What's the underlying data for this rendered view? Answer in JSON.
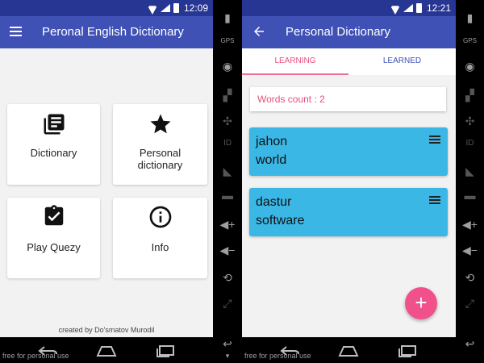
{
  "colors": {
    "status_bar": "#273593",
    "app_bar": "#3f51b5",
    "accent_pink": "#e94e7a",
    "word_card": "#3bb7e6",
    "fab": "#f0518b"
  },
  "left_screen": {
    "status_time": "12:09",
    "title": "Peronal English Dictionary",
    "tiles": [
      {
        "label": "Dictionary",
        "icon": "library-books-icon"
      },
      {
        "label": "Personal dictionary",
        "icon": "star-icon"
      },
      {
        "label": "Play Quezy",
        "icon": "clipboard-check-icon"
      },
      {
        "label": "Info",
        "icon": "info-icon"
      }
    ],
    "credit": "created by Do'smatov Murodil",
    "watermark": "free for personal use"
  },
  "right_screen": {
    "status_time": "12:21",
    "title": "Personal Dictionary",
    "tabs": [
      {
        "label": "LEARNING",
        "active": true
      },
      {
        "label": "LEARNED",
        "active": false
      }
    ],
    "words_count": "Words count : 2",
    "words": [
      {
        "word": "jahon",
        "translation": "world"
      },
      {
        "word": "dastur",
        "translation": "software"
      }
    ],
    "fab_label": "+",
    "watermark": "free for personal use"
  },
  "emulator_side_icons": [
    "battery-icon",
    "gps-icon",
    "camera-icon",
    "clapper-icon",
    "dpad-icon",
    "id-icon",
    "rss-icon",
    "sms-icon",
    "volume-up-icon",
    "volume-down-icon",
    "rotate-icon",
    "fullscreen-icon",
    "back-icon",
    "menu-icon"
  ]
}
